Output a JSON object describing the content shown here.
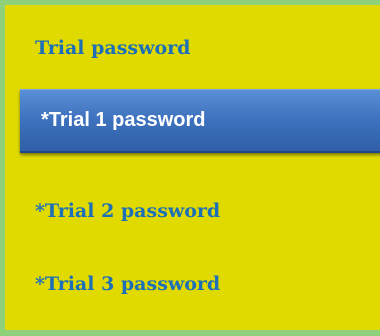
{
  "menu": {
    "heading": "Trial password",
    "items": [
      {
        "label": "*Trial 1 password",
        "active": true
      },
      {
        "label": "*Trial 2 password",
        "active": false
      },
      {
        "label": "*Trial 3 password",
        "active": false
      }
    ]
  },
  "colors": {
    "panel_background": "#e0da00",
    "panel_border": "#8fd17a",
    "link_text": "#1d6fb8",
    "active_background": "#3f73bf",
    "active_text": "#ffffff"
  }
}
